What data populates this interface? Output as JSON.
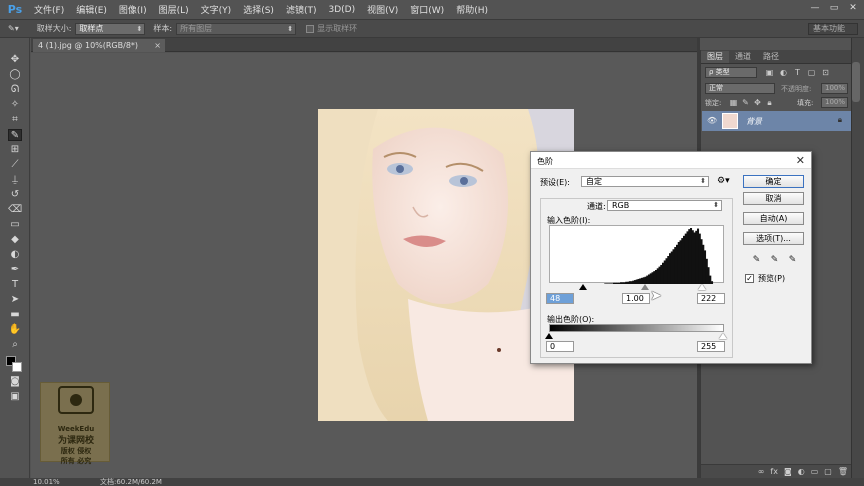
{
  "app": {
    "logo": "Ps",
    "menu": [
      "文件(F)",
      "编辑(E)",
      "图像(I)",
      "图层(L)",
      "文字(Y)",
      "选择(S)",
      "滤镜(T)",
      "3D(D)",
      "视图(V)",
      "窗口(W)",
      "帮助(H)"
    ],
    "window_controls": [
      "—",
      "▭",
      "✕"
    ]
  },
  "options_bar": {
    "sample_size_label": "取样大小:",
    "sample_size_value": "取样点",
    "sample_label": "样本:",
    "sample_value": "所有图层",
    "show_ring_label": "显示取样环",
    "workspace": "基本功能"
  },
  "document": {
    "tab_title": "4 (1).jpg @ 10%(RGB/8*)",
    "tab_close": "×"
  },
  "status": {
    "zoom": "10.01%",
    "doc_size": "文档:60.2M/60.2M"
  },
  "layers_panel": {
    "tabs": [
      "图层",
      "通道",
      "路径"
    ],
    "filter_kind": "ρ 类型",
    "blend_mode": "正常",
    "opacity_label": "不透明度:",
    "opacity_value": "100%",
    "lock_label": "锁定:",
    "fill_label": "填充:",
    "fill_value": "100%",
    "layer_name": "背景"
  },
  "levels_dialog": {
    "title": "色阶",
    "preset_label": "预设(E):",
    "preset_value": "自定",
    "channel_label": "通道:",
    "channel_value": "RGB",
    "input_levels_label": "输入色阶(I):",
    "input_black": "48",
    "input_gamma": "1.00",
    "input_white": "222",
    "output_levels_label": "输出色阶(O):",
    "output_black": "0",
    "output_white": "255",
    "ok": "确定",
    "cancel": "取消",
    "auto": "自动(A)",
    "options": "选项(T)...",
    "preview_label": "预览(P)",
    "preview_checked": "✓"
  },
  "watermark": {
    "site": "WeekEdu",
    "name": "为课网校",
    "line1": "版权 侵权",
    "line2": "所有 必究"
  },
  "histogram": {
    "bins": [
      0,
      0,
      0,
      0,
      0,
      0,
      0,
      0,
      0,
      0,
      0,
      0,
      0,
      0,
      0,
      0,
      0,
      0,
      0,
      0,
      0,
      0,
      0,
      0,
      0,
      0,
      0,
      0,
      0,
      0,
      0,
      1,
      1,
      1,
      1,
      1,
      2,
      2,
      2,
      2,
      3,
      3,
      3,
      4,
      4,
      5,
      5,
      6,
      7,
      8,
      9,
      10,
      11,
      12,
      13,
      15,
      17,
      19,
      21,
      23,
      25,
      28,
      31,
      34,
      38,
      42,
      46,
      50,
      55,
      58,
      62,
      66,
      70,
      75,
      78,
      82,
      86,
      90,
      94,
      98,
      100,
      96,
      92,
      95,
      99,
      90,
      80,
      70,
      60,
      45,
      30,
      15,
      5,
      0,
      0,
      0,
      0,
      0,
      0,
      0
    ]
  }
}
